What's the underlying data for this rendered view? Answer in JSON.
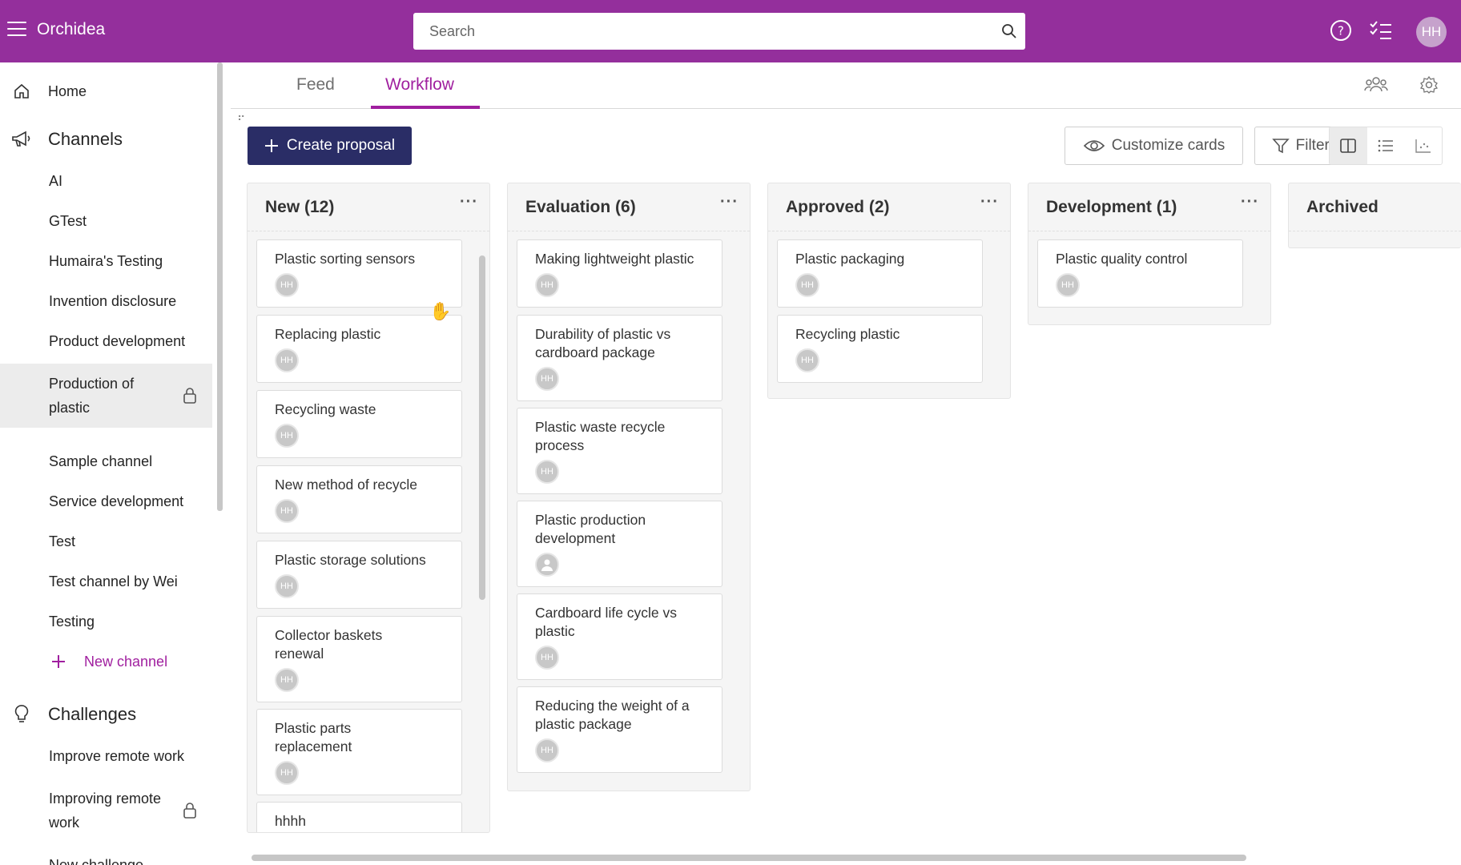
{
  "app": {
    "title": "Orchidea"
  },
  "search": {
    "placeholder": "Search"
  },
  "topbar": {
    "avatar_initials": "HH"
  },
  "sidebar": {
    "home": "Home",
    "channels_heading": "Channels",
    "channels": [
      "AI",
      "GTest",
      "Humaira's Testing",
      "Invention disclosure",
      "Product development",
      "Production of plastic",
      "Sample channel",
      "Service development",
      "Test",
      "Test channel by Wei",
      "Testing"
    ],
    "new_channel": "New channel",
    "challenges_heading": "Challenges",
    "challenges": [
      "Improve remote work",
      "Improving remote work",
      "New challenge"
    ]
  },
  "tabs": {
    "feed": "Feed",
    "workflow": "Workflow"
  },
  "toolbar": {
    "create": "Create proposal",
    "customize": "Customize cards",
    "filters": "Filters"
  },
  "columns": [
    {
      "title": "New (12)",
      "cards": [
        "Plastic sorting sensors",
        "Replacing plastic",
        "Recycling waste",
        "New method of recycle",
        "Plastic storage solutions",
        "Collector baskets renewal",
        "Plastic parts replacement",
        "hhhh"
      ]
    },
    {
      "title": "Evaluation (6)",
      "cards": [
        "Making lightweight plastic",
        "Durability of plastic vs cardboard package",
        "Plastic waste recycle process",
        "Plastic production development",
        "Cardboard life cycle vs plastic",
        "Reducing the weight of a plastic package"
      ]
    },
    {
      "title": "Approved (2)",
      "cards": [
        "Plastic packaging",
        "Recycling plastic"
      ]
    },
    {
      "title": "Development (1)",
      "cards": [
        "Plastic quality control"
      ]
    },
    {
      "title": "Archived",
      "cards": []
    }
  ],
  "card_avatar": "HH",
  "colors": {
    "brand": "#942f9c",
    "accent": "#a01f9f",
    "create_button": "#2a2d66"
  }
}
